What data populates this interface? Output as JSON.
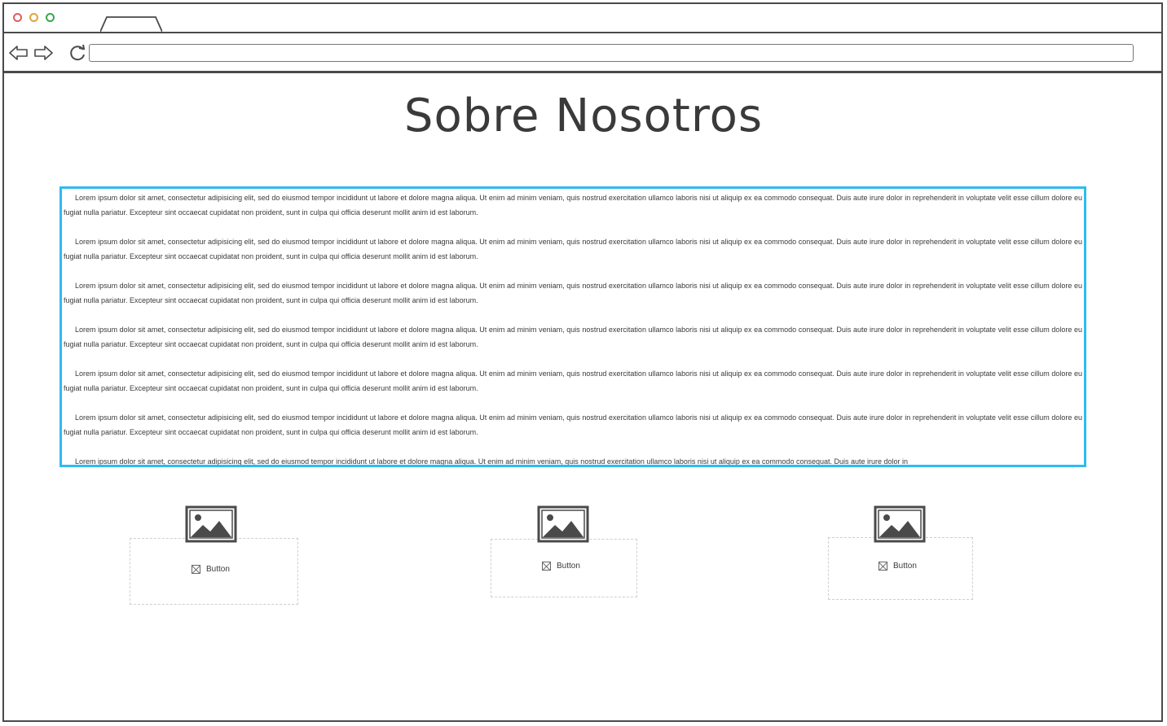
{
  "browser": {
    "url_value": "",
    "icons": {
      "back": "back-arrow-icon",
      "forward": "forward-arrow-icon",
      "reload": "reload-icon"
    },
    "window_controls": {
      "close_color": "#e25b5b",
      "minimize_color": "#e0a43a",
      "maximize_color": "#3aa64f"
    }
  },
  "page": {
    "title": "Sobre Nosotros",
    "textarea_border_color": "#2fbaf2",
    "paragraphs": [
      "Lorem ipsum dolor sit amet, consectetur adipisicing elit, sed do eiusmod tempor incididunt ut labore et dolore magna aliqua. Ut enim ad minim veniam, quis nostrud exercitation ullamco laboris nisi ut aliquip ex ea commodo consequat. Duis aute irure dolor in reprehenderit in voluptate velit esse cillum dolore eu fugiat nulla pariatur. Excepteur sint occaecat cupidatat non proident, sunt in culpa qui officia deserunt mollit anim id est laborum.",
      "Lorem ipsum dolor sit amet, consectetur adipisicing elit, sed do eiusmod tempor incididunt ut labore et dolore magna aliqua. Ut enim ad minim veniam, quis nostrud exercitation ullamco laboris nisi ut aliquip ex ea commodo consequat. Duis aute irure dolor in reprehenderit in voluptate velit esse cillum dolore eu fugiat nulla pariatur. Excepteur sint occaecat cupidatat non proident, sunt in culpa qui officia deserunt mollit anim id est laborum.",
      "Lorem ipsum dolor sit amet, consectetur adipisicing elit, sed do eiusmod tempor incididunt ut labore et dolore magna aliqua. Ut enim ad minim veniam, quis nostrud exercitation ullamco laboris nisi ut aliquip ex ea commodo consequat. Duis aute irure dolor in reprehenderit in voluptate velit esse cillum dolore eu fugiat nulla pariatur. Excepteur sint occaecat cupidatat non proident, sunt in culpa qui officia deserunt mollit anim id est laborum.",
      "Lorem ipsum dolor sit amet, consectetur adipisicing elit, sed do eiusmod tempor incididunt ut labore et dolore magna aliqua. Ut enim ad minim veniam, quis nostrud exercitation ullamco laboris nisi ut aliquip ex ea commodo consequat. Duis aute irure dolor in reprehenderit in voluptate velit esse cillum dolore eu fugiat nulla pariatur. Excepteur sint occaecat cupidatat non proident, sunt in culpa qui officia deserunt mollit anim id est laborum.",
      "Lorem ipsum dolor sit amet, consectetur adipisicing elit, sed do eiusmod tempor incididunt ut labore et dolore magna aliqua. Ut enim ad minim veniam, quis nostrud exercitation ullamco laboris nisi ut aliquip ex ea commodo consequat. Duis aute irure dolor in reprehenderit in voluptate velit esse cillum dolore eu fugiat nulla pariatur. Excepteur sint occaecat cupidatat non proident, sunt in culpa qui officia deserunt mollit anim id est laborum.",
      "Lorem ipsum dolor sit amet, consectetur adipisicing elit, sed do eiusmod tempor incididunt ut labore et dolore magna aliqua. Ut enim ad minim veniam, quis nostrud exercitation ullamco laboris nisi ut aliquip ex ea commodo consequat. Duis aute irure dolor in reprehenderit in voluptate velit esse cillum dolore eu fugiat nulla pariatur. Excepteur sint occaecat cupidatat non proident, sunt in culpa qui officia deserunt mollit anim id est laborum.",
      "Lorem ipsum dolor sit amet, consectetur adipisicing elit, sed do eiusmod tempor incididunt ut labore et dolore magna aliqua. Ut enim ad minim veniam, quis nostrud exercitation ullamco laboris nisi ut aliquip ex ea commodo consequat. Duis aute irure dolor in"
    ]
  },
  "cards": [
    {
      "image_icon": "image-placeholder-icon",
      "button_label": "Button"
    },
    {
      "image_icon": "image-placeholder-icon",
      "button_label": "Button"
    },
    {
      "image_icon": "image-placeholder-icon",
      "button_label": "Button"
    }
  ]
}
